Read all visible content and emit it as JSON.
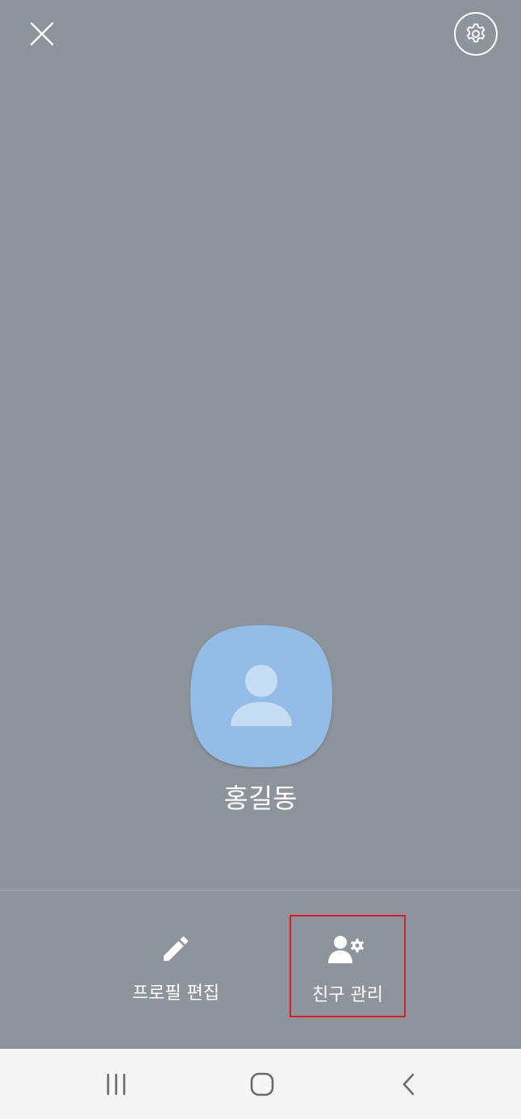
{
  "header": {
    "close_icon": "close-icon",
    "settings_icon": "gear-icon"
  },
  "profile": {
    "name": "홍길동",
    "avatar_icon": "person-icon",
    "avatar_color": "#93bce6"
  },
  "actions": [
    {
      "label": "프로필 편집",
      "icon": "pencil-icon"
    },
    {
      "label": "친구 관리",
      "icon": "user-settings-icon"
    }
  ],
  "navbar": {
    "recent_icon": "recent-apps-icon",
    "home_icon": "home-icon",
    "back_icon": "back-icon"
  },
  "colors": {
    "background": "#8d949b",
    "highlight": "#e01b24",
    "navbar": "#f5f5f5"
  }
}
